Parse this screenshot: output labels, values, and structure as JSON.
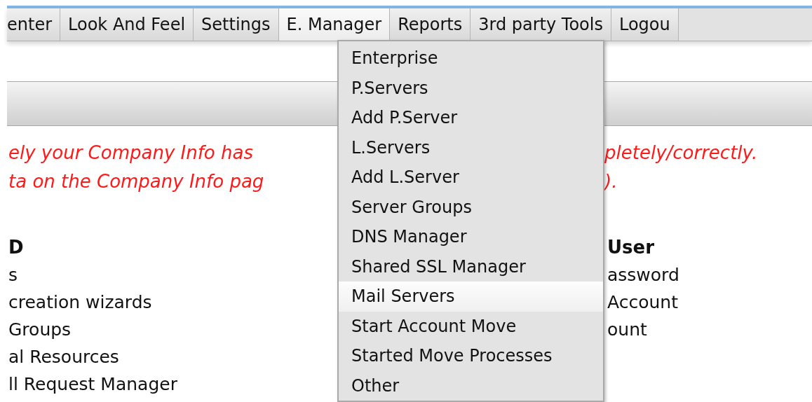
{
  "tabs": [
    {
      "label": "enter",
      "selected": false
    },
    {
      "label": "Look And Feel",
      "selected": false
    },
    {
      "label": "Settings",
      "selected": false
    },
    {
      "label": "E. Manager",
      "selected": true
    },
    {
      "label": "Reports",
      "selected": false
    },
    {
      "label": "3rd party Tools",
      "selected": false
    },
    {
      "label": "Logou",
      "selected": false
    }
  ],
  "dropdown": {
    "items": [
      {
        "label": "Enterprise",
        "selected": false
      },
      {
        "label": "P.Servers",
        "selected": false
      },
      {
        "label": "Add P.Server",
        "selected": false
      },
      {
        "label": "L.Servers",
        "selected": false
      },
      {
        "label": "Add L.Server",
        "selected": false
      },
      {
        "label": "Server Groups",
        "selected": false
      },
      {
        "label": "DNS Manager",
        "selected": false
      },
      {
        "label": "Shared SSL Manager",
        "selected": false
      },
      {
        "label": "Mail Servers",
        "selected": true
      },
      {
        "label": "Start Account Move",
        "selected": false
      },
      {
        "label": "Started Move Processes",
        "selected": false
      },
      {
        "label": "Other",
        "selected": false
      }
    ]
  },
  "notice": {
    "lines": [
      {
        "left": "ely your Company Info has",
        "right": "pletely/correctly."
      },
      {
        "left": "ta on the Company Info pag",
        "right": ")."
      }
    ]
  },
  "columns": [
    {
      "heading": "D",
      "items": [
        "s",
        "creation wizards",
        "Groups",
        "al Resources",
        "ll Request Manager"
      ]
    },
    {
      "heading": "User",
      "items": [
        "assword",
        "Account",
        "ount"
      ]
    }
  ]
}
